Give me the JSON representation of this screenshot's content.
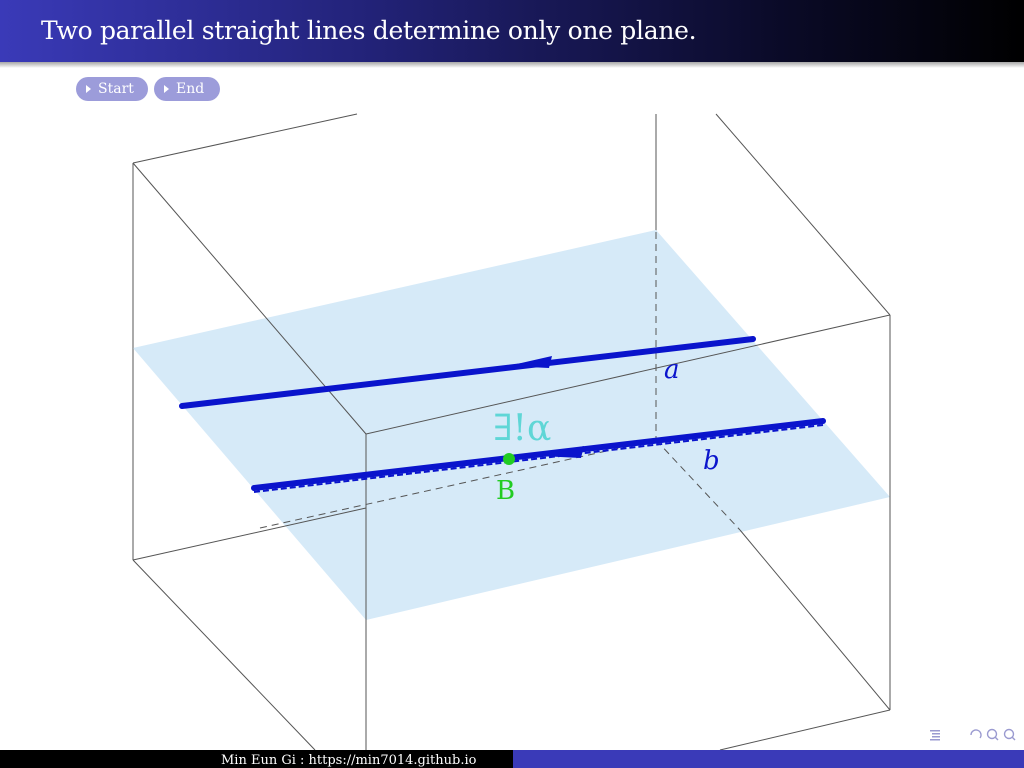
{
  "slide": {
    "title": "Two parallel straight lines determine only one plane."
  },
  "controls": {
    "start_label": "Start",
    "end_label": "End"
  },
  "figure": {
    "line_a_label": "a",
    "line_b_label": "b",
    "plane_label": "∃!α",
    "point_label": "B",
    "colors": {
      "plane": "#d6eaf8",
      "lines": "#0a14cc",
      "point": "#22cc22",
      "plane_label": "#5fd6d6",
      "box": "#555555"
    }
  },
  "footer": {
    "text": "Min Eun Gi : https://min7014.github.io"
  },
  "nav": {
    "outline_icon": "outline-icon",
    "search_icon": "search-zoom-icon"
  }
}
